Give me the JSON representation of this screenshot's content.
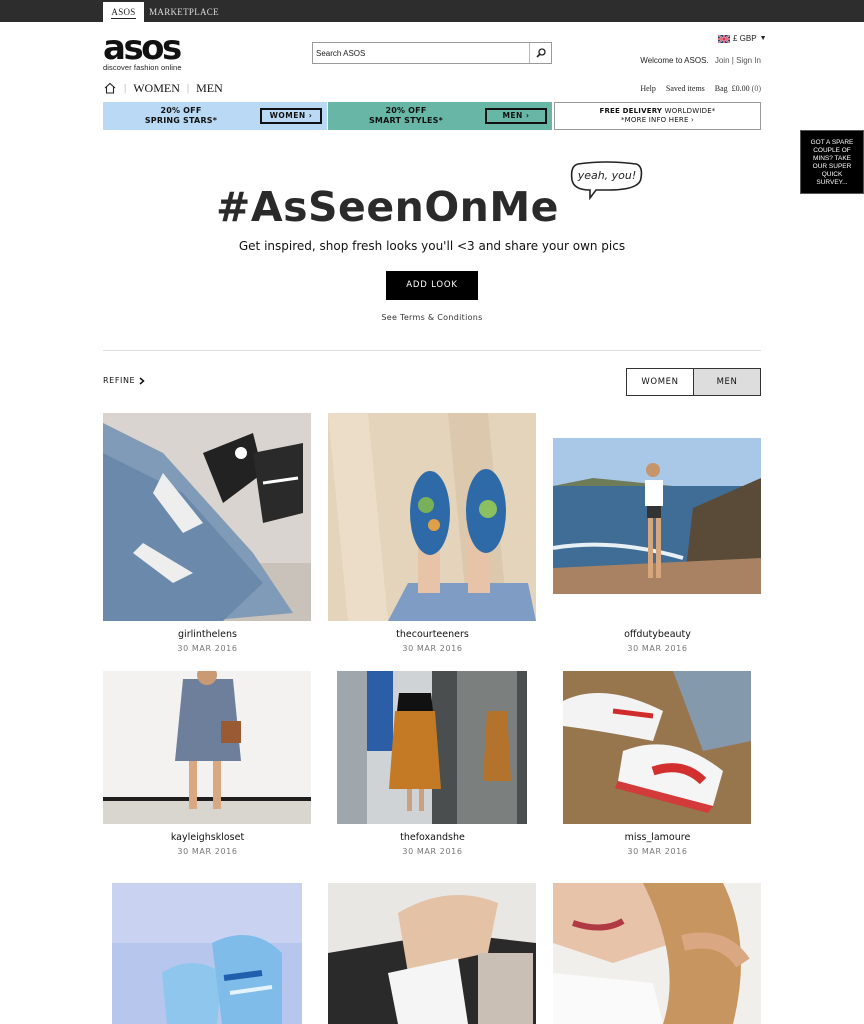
{
  "topbar": {
    "tabs": [
      "ASOS",
      "MARKETPLACE"
    ]
  },
  "header": {
    "logo_text": "asos",
    "logo_tagline": "discover fashion online",
    "search_placeholder": "Search ASOS",
    "currency": "£ GBP",
    "welcome": "Welcome to ASOS.",
    "join": "Join",
    "sign_in": "Sign In",
    "nav": [
      "WOMEN",
      "MEN"
    ],
    "utils": {
      "help": "Help",
      "saved": "Saved items",
      "bag": "Bag",
      "bag_total": "£0.00",
      "bag_count": "(0)"
    }
  },
  "promos": {
    "women": {
      "line1": "20% OFF",
      "line2": "SPRING STARS*",
      "button": "WOMEN ›"
    },
    "men": {
      "line1": "20% OFF",
      "line2": "SMART STYLES*",
      "button": "MEN ›"
    },
    "delivery": {
      "strong": "FREE DELIVERY",
      "rest": " WORLDWIDE*",
      "line2": "*MORE INFO HERE ›"
    }
  },
  "survey": "GOT A SPARE COUPLE OF MINS? TAKE OUR SUPER QUICK SURVEY...",
  "hero": {
    "title": "#AsSeenOnMe",
    "bubble": "yeah, you!",
    "subtitle": "Get inspired, shop fresh looks you'll <3 and share your own pics",
    "button": "ADD LOOK",
    "terms": "See Terms & Conditions"
  },
  "filters": {
    "refine": "REFINE",
    "women": "WOMEN",
    "men": "MEN",
    "selected": "MEN"
  },
  "looks": [
    {
      "user": "girlinthelens",
      "date": "30 MAR 2016"
    },
    {
      "user": "thecourteeners",
      "date": "30 MAR 2016"
    },
    {
      "user": "offdutybeauty",
      "date": "30 MAR 2016"
    },
    {
      "user": "kayleighskloset",
      "date": "30 MAR 2016"
    },
    {
      "user": "thefoxandshe",
      "date": "30 MAR 2016"
    },
    {
      "user": "miss_lamoure",
      "date": "30 MAR 2016"
    },
    {
      "user": "",
      "date": ""
    },
    {
      "user": "",
      "date": ""
    },
    {
      "user": "",
      "date": ""
    }
  ],
  "colors": {
    "women_banner": "#b9d9f4",
    "men_banner": "#67b6a6",
    "topbar": "#2d2d2d",
    "button_black": "#000000"
  }
}
